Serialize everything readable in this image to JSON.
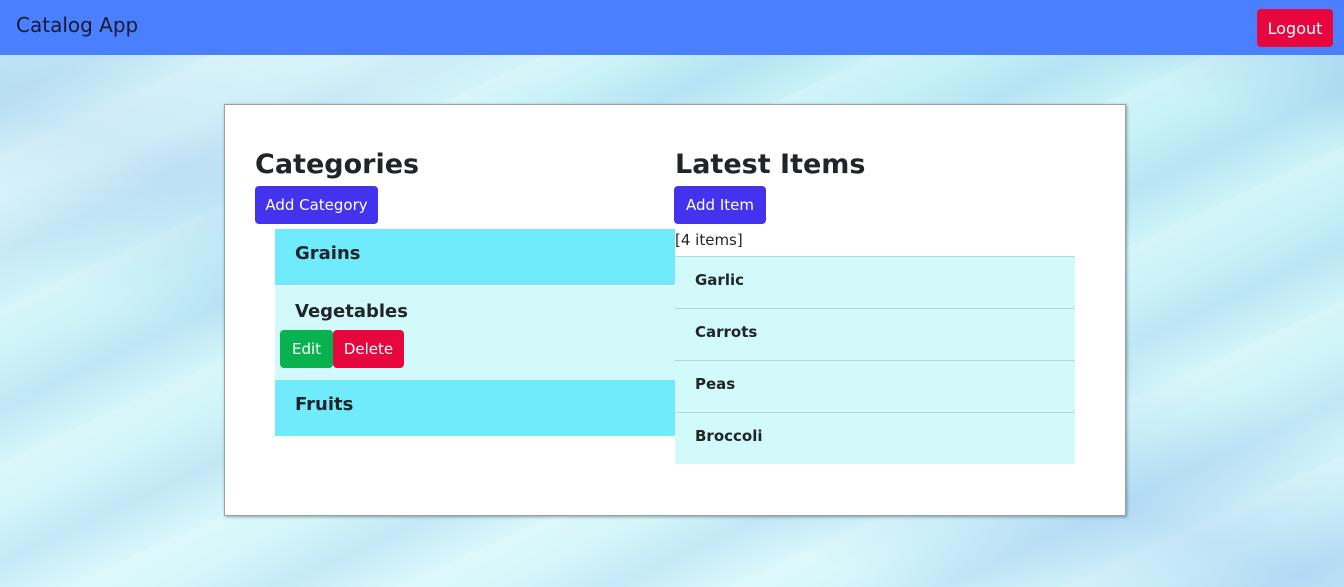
{
  "navbar": {
    "brand": "Catalog App",
    "logout_label": "Logout"
  },
  "categories": {
    "title": "Categories",
    "add_label": "Add Category",
    "items": [
      {
        "label": "Grains",
        "expanded": false
      },
      {
        "label": "Vegetables",
        "expanded": true,
        "edit_label": "Edit",
        "delete_label": "Delete"
      },
      {
        "label": "Fruits",
        "expanded": false
      }
    ]
  },
  "latest": {
    "title": "Latest Items",
    "add_label": "Add Item",
    "count_text": "[4 items]",
    "items": [
      "Garlic",
      "Carrots",
      "Peas",
      "Broccoli"
    ]
  },
  "colors": {
    "navbar": "#4a7fff",
    "primary": "#4433ee",
    "danger": "#e8063e",
    "success": "#08b34f",
    "category_closed": "#70ebfb",
    "category_open": "#d3fafa"
  }
}
